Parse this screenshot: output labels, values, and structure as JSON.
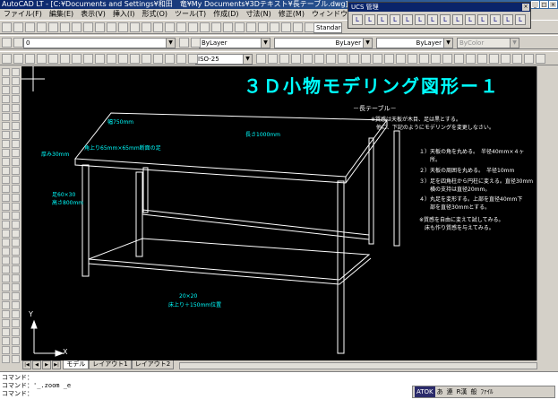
{
  "window": {
    "title": "AutoCAD LT - [C:¥Documents and Settings¥和田　竜¥My Documents¥3Dテキスト¥長テーブル.dwg]"
  },
  "menu": [
    "ファイル(F)",
    "編集(E)",
    "表示(V)",
    "挿入(I)",
    "形式(O)",
    "ツール(T)",
    "作成(D)",
    "寸法(N)",
    "修正(M)",
    "ウィンドウ(W)",
    "ヘルプ(H)"
  ],
  "toolbar1": {
    "text_style": "Standard"
  },
  "toolbar2": {
    "layer": "0",
    "color": "ByLayer",
    "linetype": "ByLayer",
    "lineweight": "ByLayer",
    "plotstyle": "ByColor"
  },
  "toolbar3": {
    "dimstyle": "ISO-25"
  },
  "ucs_panel": {
    "title": "UCS 管理",
    "close": "×",
    "icons": [
      "L",
      "L",
      "L",
      "L",
      "L",
      "L",
      "L",
      "L",
      "L",
      "L",
      "L",
      "L",
      "L",
      "L"
    ]
  },
  "drawing": {
    "title": "３Ｄ小物モデリング図形ー１",
    "subtitle": "－長テーブル－",
    "notes": [
      "※質感は天板が木目、足は黒とする。",
      "　他に、下記のようにモデリングを変更しなさい。"
    ],
    "list": [
      "１）天板の角を丸める。　半径40mm×４ヶ",
      "　　所。",
      "２）天板の周囲を丸める。　半径10mm",
      "３）足を四角柱から円柱に変える。直径30mm",
      "　　横の支持は直径20mm。",
      "４）丸足を変形する。上部を直径40mm下",
      "　　部を直径30mmとする。",
      "※質感を自由に変えて試してみる。",
      "　床も作り質感を与えてみる。"
    ],
    "labels": {
      "depth": "幅750mm",
      "length": "長さ1000mm",
      "thickness": "厚み30mm",
      "corner": "角上り65mm×65mm断面の足",
      "leg_size": "足60×30",
      "leg_height": "高さ800mm",
      "brace_size": "20×20",
      "brace_height": "床上り＋150mm位置"
    },
    "axis": {
      "y": "Y",
      "x": "X"
    }
  },
  "tabs": [
    "モデル",
    "レイアウト1",
    "レイアウト2"
  ],
  "command": [
    "コマンド：",
    "コマンド：'_.zoom _e",
    "コマンド："
  ],
  "status": {
    "ime": "ATOK",
    "items": [
      "あ",
      "連",
      "R漢",
      "般",
      "ﾌｧｲﾙ"
    ]
  }
}
